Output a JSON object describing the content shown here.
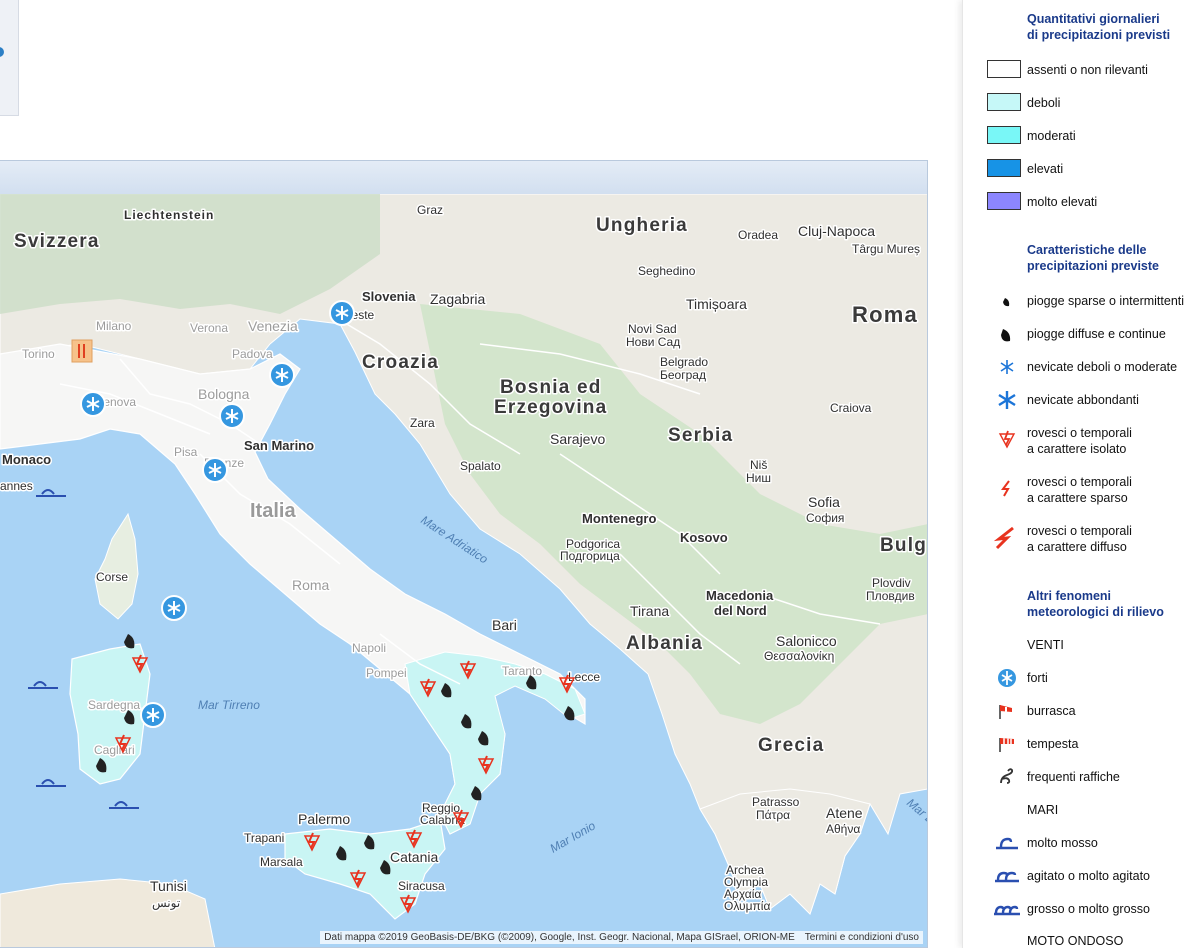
{
  "map": {
    "countries": [
      "Svizzera",
      "Liechtenstein",
      "Ungheria",
      "Roma",
      "Croazia",
      "Slovenia",
      "Bosnia ed",
      "Erzegovina",
      "Serbia",
      "Montenegro",
      "Kosovo",
      "Bulg",
      "Albania",
      "Macedonia",
      "del Nord",
      "Grecia",
      "Italia",
      "Monaco",
      "San Marino"
    ],
    "cities": [
      "Graz",
      "Oradea",
      "Cluj-Napoca",
      "Târgu Mureș",
      "Seghedino",
      "Timișoara",
      "Zagabria",
      "Trieste",
      "Novi Sad",
      "Нови Сад",
      "Belgrado",
      "Београд",
      "Milano",
      "Verona",
      "Venezia",
      "Padova",
      "Torino",
      "Bologna",
      "Genova",
      "Pisa",
      "Firenze",
      "Zara",
      "Sarajevo",
      "Spalato",
      "Craiova",
      "Niš",
      "Ниш",
      "Sofia",
      "София",
      "Podgorica",
      "Подгорица",
      "Plovdiv",
      "Пловдив",
      "Corse",
      "Roma",
      "Bari",
      "Napoli",
      "Pompei",
      "Taranto",
      "Lecce",
      "Tirana",
      "Salonicco",
      "Θεσσαλονίκη",
      "Sardegna",
      "Cagliari",
      "Palermo",
      "Trapani",
      "Marsala",
      "Catania",
      "Siracusa",
      "Reggio Calabria",
      "Patrasso",
      "Πάτρα",
      "Atene",
      "Αθήνα",
      "Archea Olympia",
      "Αρχαία Ολυμπία",
      "Tunisi",
      "تونس",
      "annes"
    ],
    "seas": [
      "Mare Adriatico",
      "Mar Tirreno",
      "Mar Ionio",
      "Mar E"
    ],
    "attribution": "Dati mappa ©2019 GeoBasis-DE/BKG (©2009), Google, Inst. Geogr. Nacional, Mapa GISrael, ORION-ME",
    "terms": "Termini e condizioni d'uso",
    "colors": {
      "sea": "#a9d3f5",
      "land": "#f1f0ec",
      "italy": "#f7f7f7",
      "deboli": "#c9f5f4"
    }
  },
  "legend": {
    "title1": [
      "Quantitativi giornalieri",
      "di precipitazioni previsti"
    ],
    "amounts": [
      {
        "label": "assenti o non rilevanti",
        "color": "#ffffff"
      },
      {
        "label": "deboli",
        "color": "#c6f8f8"
      },
      {
        "label": "moderati",
        "color": "#79f7f7"
      },
      {
        "label": "elevati",
        "color": "#1793e6"
      },
      {
        "label": "molto elevati",
        "color": "#8c86ff"
      }
    ],
    "title2": [
      "Caratteristiche delle",
      "precipitazioni previste"
    ],
    "characteristics": [
      {
        "icon": "drop-small-icon",
        "label": [
          "piogge sparse o intermittenti"
        ]
      },
      {
        "icon": "drop-large-icon",
        "label": [
          "piogge diffuse e continue"
        ]
      },
      {
        "icon": "snowflake-small-icon",
        "label": [
          "nevicate deboli o moderate"
        ]
      },
      {
        "icon": "snowflake-large-icon",
        "label": [
          "nevicate abbondanti"
        ]
      },
      {
        "icon": "storm-isolated-icon",
        "label": [
          "rovesci o temporali",
          "a carattere isolato"
        ]
      },
      {
        "icon": "storm-scattered-icon",
        "label": [
          "rovesci o temporali",
          "a carattere sparso"
        ]
      },
      {
        "icon": "storm-diffuse-icon",
        "label": [
          "rovesci o temporali",
          "a carattere diffuso"
        ]
      }
    ],
    "title3": [
      "Altri fenomeni",
      "meteorologici di rilievo"
    ],
    "venti_heading": "VENTI",
    "winds": [
      {
        "icon": "wind-strong-icon",
        "label": "forti"
      },
      {
        "icon": "windsock-gale-icon",
        "label": "burrasca"
      },
      {
        "icon": "windsock-storm-icon",
        "label": "tempesta"
      },
      {
        "icon": "gust-icon",
        "label": "frequenti raffiche"
      }
    ],
    "mari_heading": "MARI",
    "seas": [
      {
        "icon": "wave-single-icon",
        "label": "molto mosso"
      },
      {
        "icon": "wave-double-icon",
        "label": "agitato o molto agitato"
      },
      {
        "icon": "wave-triple-icon",
        "label": "grosso o molto grosso"
      }
    ],
    "moto_heading": "MOTO ONDOSO"
  }
}
